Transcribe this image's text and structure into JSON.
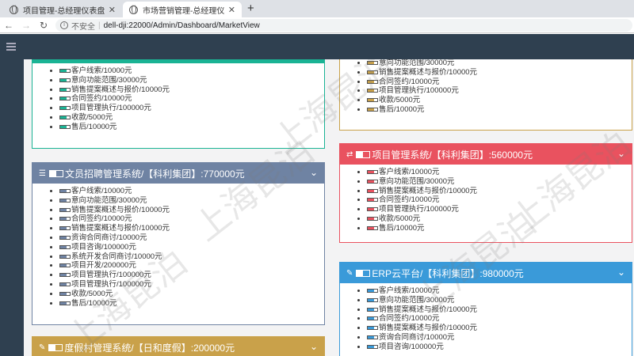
{
  "browser": {
    "tabs": [
      {
        "label": "项目管理-总经理仪表盘"
      },
      {
        "label": "市场营销管理-总经理仪表盘"
      }
    ],
    "insecure_label": "不安全",
    "url": "dell-dji:22000/Admin/Dashboard/MarketView"
  },
  "watermark": "上海昆泊",
  "panels": [
    {
      "id": "top-left",
      "title": "",
      "color": "#1ab394",
      "items": [
        "客户线索/10000元",
        "意向功能范围/30000元",
        "销售提案概述与报价/10000元",
        "合同签约/10000元",
        "项目管理执行/100000元",
        "收款/5000元",
        "售后/10000元"
      ]
    },
    {
      "id": "hr",
      "title": "文员招聘管理系统/【科利集团】:770000元",
      "color": "#6f83a3",
      "items": [
        "客户线索/10000元",
        "意向功能范围/30000元",
        "销售提案概述与报价/10000元",
        "合同签约/10000元",
        "销售提案概述与报价/10000元",
        "资询合同商讨/10000元",
        "项目咨询/100000元",
        "系统开发合同商讨/10000元",
        "项目开发/200000元",
        "项目管理执行/100000元",
        "项目管理执行/100000元",
        "收款/5000元",
        "售后/10000元"
      ]
    },
    {
      "id": "resort",
      "title": "度假村管理系统/【日和度假】:200000元",
      "color": "#c9a14a",
      "items": []
    },
    {
      "id": "top-right",
      "title": "",
      "color": "#c9a14a",
      "items": [
        "意向功能范围/30000元",
        "销售提案概述与报价/10000元",
        "合同签约/10000元",
        "项目管理执行/100000元",
        "收款/5000元",
        "售后/10000元"
      ]
    },
    {
      "id": "pm",
      "title": "项目管理系统/【科利集团】:560000元",
      "color": "#e9525f",
      "items": [
        "客户线索/10000元",
        "意向功能范围/30000元",
        "销售提案概述与报价/10000元",
        "合同签约/10000元",
        "项目管理执行/100000元",
        "收款/5000元",
        "售后/10000元"
      ]
    },
    {
      "id": "erp",
      "title": "ERP云平台/【科利集团】:980000元",
      "color": "#3a9ad9",
      "items": [
        "客户线索/10000元",
        "意向功能范围/30000元",
        "销售提案概述与报价/10000元",
        "合同签约/10000元",
        "销售提案概述与报价/10000元",
        "资询合同商讨/10000元",
        "项目咨询/100000元"
      ]
    }
  ]
}
